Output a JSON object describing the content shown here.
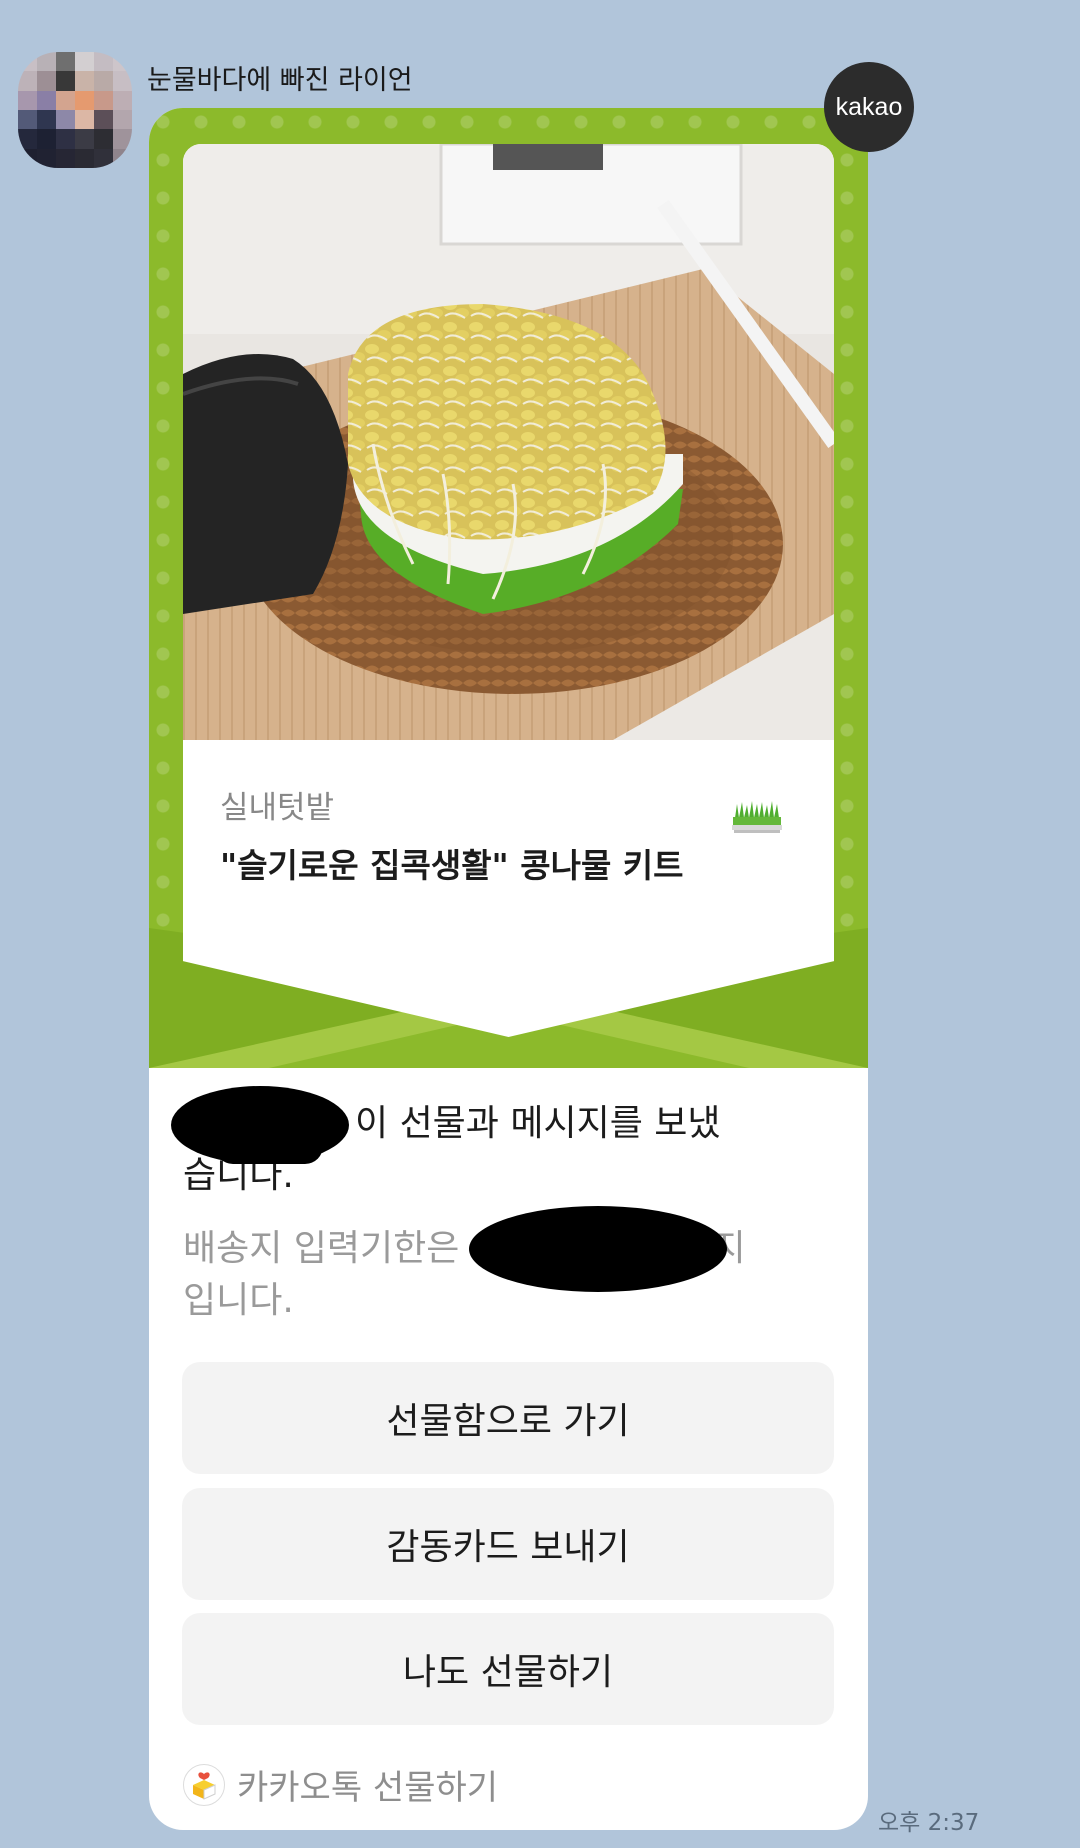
{
  "sender": {
    "name": "눈물바다에 빠진 라이언",
    "avatar_icon": "pixelated-avatar"
  },
  "badge": {
    "label": "kakao",
    "color": "#2c2c2c"
  },
  "card": {
    "accent_color": "#8cba2b",
    "product": {
      "category": "실내텃밭",
      "name": "\"슬기로운 집콕생활\" 콩나물 키트",
      "photo_icon": "bean-sprout-photo",
      "thumb_icon": "grass-planter-icon"
    },
    "message": {
      "title_suffix": "이 선물과 메시지를 보냈습니다.",
      "sub_prefix": "배송지 입력기한은",
      "sub_suffix": "까지 입니다."
    },
    "buttons": [
      {
        "label": "선물함으로 가기"
      },
      {
        "label": "감동카드 보내기"
      },
      {
        "label": "나도 선물하기"
      }
    ],
    "footer": {
      "label": "카카오톡 선물하기",
      "icon": "gift-box-icon"
    }
  },
  "timestamp": "오후 2:37"
}
